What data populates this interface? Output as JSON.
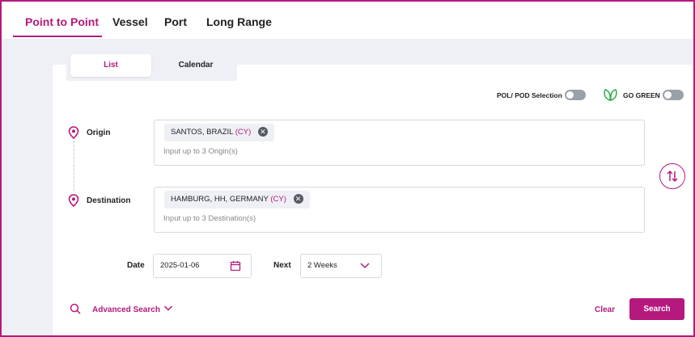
{
  "tabs": [
    "Point to Point",
    "Vessel",
    "Port",
    "Long Range"
  ],
  "subtabs": {
    "list": "List",
    "calendar": "Calendar"
  },
  "toggles": {
    "pol_pod": "POL/ POD Selection",
    "go_green": "GO GREEN"
  },
  "origin": {
    "label": "Origin",
    "chip_name": "SANTOS, BRAZIL",
    "chip_code": "(CY)",
    "placeholder": "Input up to 3 Origin(s)"
  },
  "destination": {
    "label": "Destination",
    "chip_name": "HAMBURG, HH, GERMANY",
    "chip_code": "(CY)",
    "placeholder": "Input up to 3 Destination(s)"
  },
  "date": {
    "label": "Date",
    "value": "2025-01-06"
  },
  "next": {
    "label": "Next",
    "value": "2 Weeks"
  },
  "actions": {
    "advanced_search": "Advanced Search",
    "clear": "Clear",
    "search": "Search"
  },
  "colors": {
    "accent": "#b5197d",
    "green": "#2eaa4a"
  }
}
